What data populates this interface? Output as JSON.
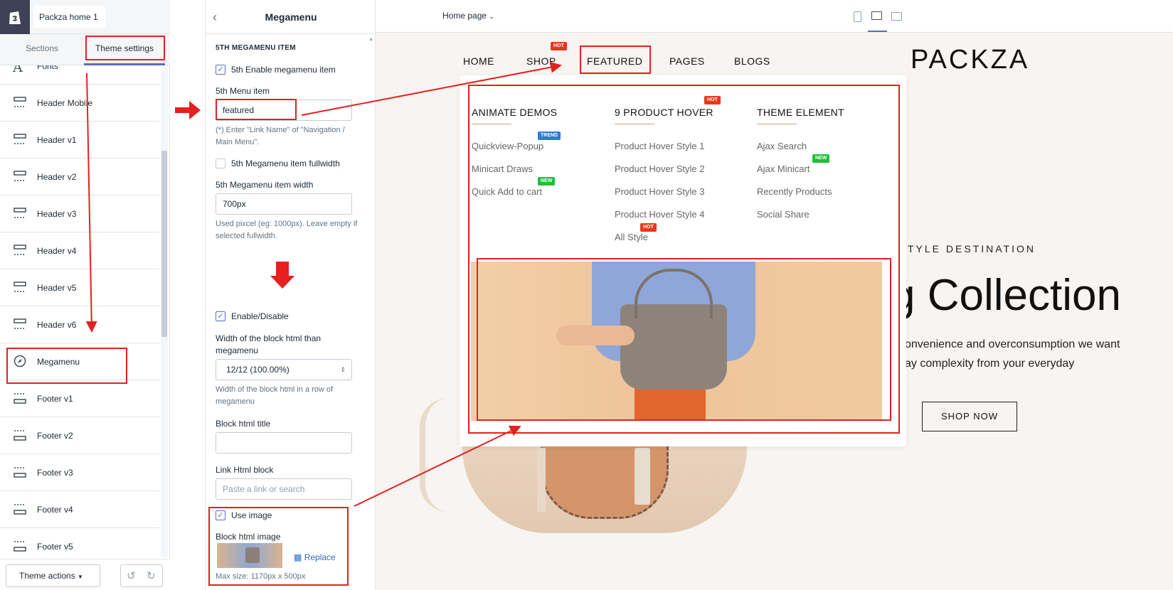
{
  "left_panel": {
    "store_name": "Packza home 1",
    "tabs": [
      "Sections",
      "Theme settings"
    ],
    "items": [
      "Fonts",
      "Header Mobile",
      "Header v1",
      "Header v2",
      "Header v3",
      "Header v4",
      "Header v5",
      "Header v6",
      "Megamenu",
      "Footer v1",
      "Footer v2",
      "Footer v3",
      "Footer v4",
      "Footer v5"
    ],
    "theme_actions": "Theme actions"
  },
  "mid_panel": {
    "title": "Megamenu",
    "section_heading": "5TH MEGAMENU ITEM",
    "enable_label": "5th Enable megamenu item",
    "menu_item_label": "5th Menu item",
    "menu_item_value": "featured",
    "menu_item_help": "(*) Enter \"Link Name\" of \"Navigation / Main Menu\".",
    "fullwidth_label": "5th Megamenu item fullwidth",
    "width_label": "5th Megamenu item width",
    "width_value": "700px",
    "width_help": "Used pixcel (eg: 1000px). Leave empty if selected fullwidth.",
    "block_enable_label": "Enable/Disable",
    "block_width_label": "Width of the block html than megamenu",
    "block_width_value": "12/12 (100.00%)",
    "block_width_help": "Width of the block html in a row of megamenu",
    "block_title_label": "Block html title",
    "link_label": "Link Html block",
    "link_placeholder": "Paste a link or search",
    "use_image_label": "Use image",
    "image_label": "Block html image",
    "replace_label": "Replace",
    "max_size": "Max size: 1170px x 500px"
  },
  "preview": {
    "page_select": "Home page",
    "nav": [
      "HOME",
      "SHOP",
      "FEATURED",
      "PAGES",
      "BLOGS"
    ],
    "logo": "PACKZA",
    "hero_kicker": "TYLE DESTINATION",
    "hero_title": "g Collection",
    "hero_text_1": "onvenience and overconsumption we want",
    "hero_text_2": "ay complexity from your everyday",
    "shop_now": "SHOP NOW",
    "badges": {
      "hot": "HOT",
      "trend": "TREND",
      "new": "NEW"
    },
    "megamenu": {
      "columns": [
        {
          "title": "ANIMATE DEMOS",
          "links": [
            "Quickview-Popup",
            "Minicart Draws",
            "Quick Add to cart"
          ]
        },
        {
          "title": "9 PRODUCT HOVER",
          "links": [
            "Product Hover Style 1",
            "Product Hover Style 2",
            "Product Hover Style 3",
            "Product Hover Style 4",
            "All Style"
          ]
        },
        {
          "title": "THEME ELEMENT",
          "links": [
            "Ajax Search",
            "Ajax Minicart",
            "Recently Products",
            "Social Share"
          ]
        }
      ]
    }
  },
  "colors": {
    "annotation_red": "#e5201e",
    "accent": "#5c6ac4",
    "shopify_dark": "#3e4155",
    "badge_hot": "#e8381c",
    "badge_trend": "#2d7bd6",
    "badge_new": "#1fbf3a"
  }
}
